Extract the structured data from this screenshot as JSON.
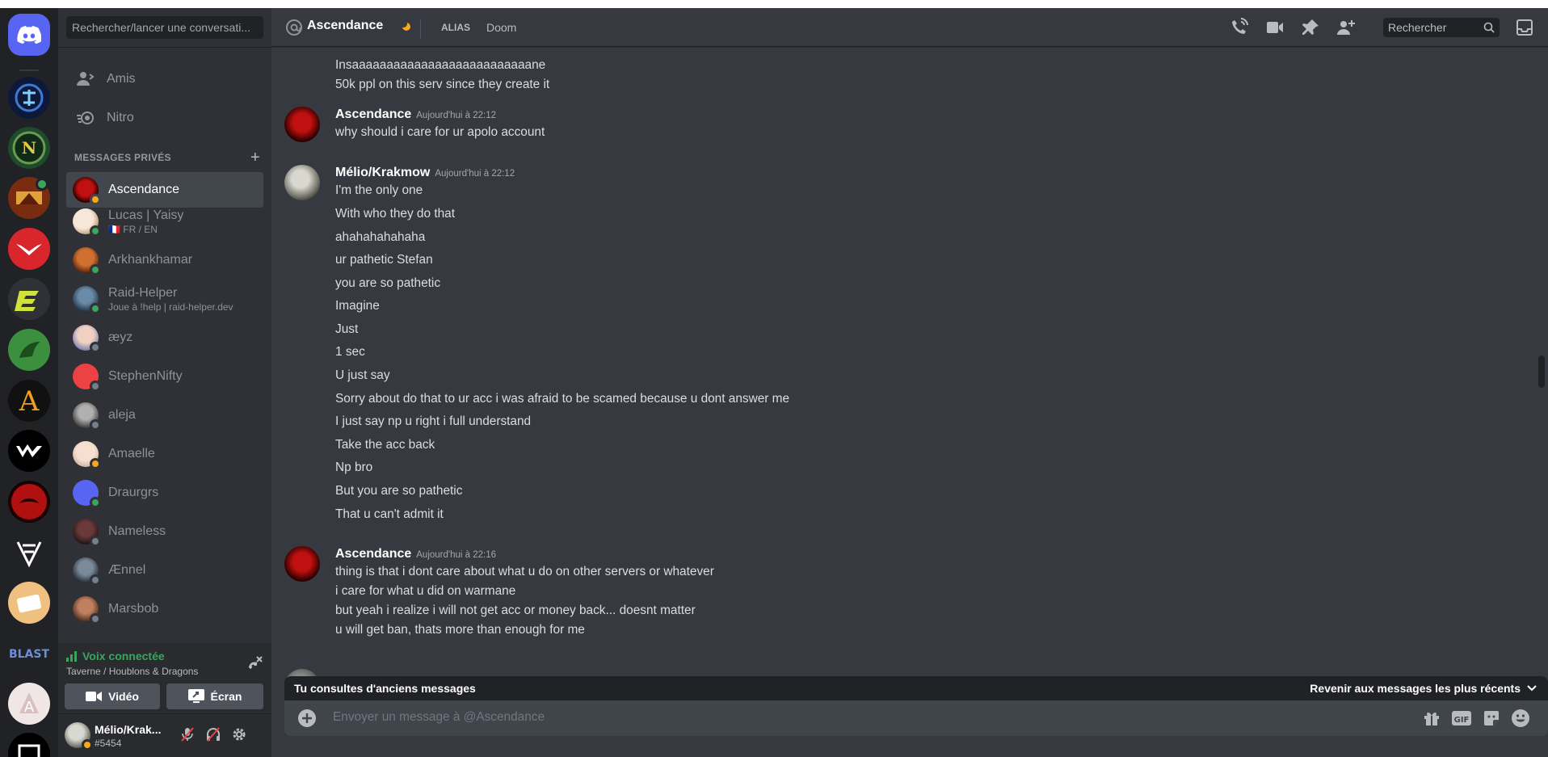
{
  "colors": {
    "accent": "#5865f2",
    "online": "#3ba55d",
    "idle": "#faa81a",
    "offline": "#747f8d"
  },
  "sidebar": {
    "search_placeholder": "Rechercher/lancer une conversati...",
    "nav": [
      {
        "label": "Amis",
        "icon": "friends-icon"
      },
      {
        "label": "Nitro",
        "icon": "nitro-icon"
      }
    ],
    "dm_header": "MESSAGES PRIVÉS",
    "dms": [
      {
        "name": "Ascendance",
        "status": "idle",
        "active": true
      },
      {
        "name": "Lucas | Yaisy",
        "sub": "🇫🇷 FR / EN",
        "status": "online"
      },
      {
        "name": "Arkhankhamar",
        "status": "online"
      },
      {
        "name": "Raid-Helper",
        "sub": "Joue à !help | raid-helper.dev",
        "status": "online"
      },
      {
        "name": "æyz",
        "status": "offline"
      },
      {
        "name": "StephenNifty",
        "status": "offline"
      },
      {
        "name": "aleja",
        "status": "offline"
      },
      {
        "name": "Amaelle",
        "status": "idle"
      },
      {
        "name": "Draurgrs",
        "status": "online"
      },
      {
        "name": "Nameless",
        "status": "offline"
      },
      {
        "name": "Ænnel",
        "status": "offline"
      },
      {
        "name": "Marsbob",
        "status": "offline"
      }
    ],
    "voice": {
      "status": "Voix connectée",
      "channel": "Taverne / Houblons & Dragons",
      "video_label": "Vidéo",
      "screen_label": "Écran"
    },
    "user": {
      "name": "Mélio/Krak...",
      "tag": "#5454"
    }
  },
  "header": {
    "channel": "Ascendance",
    "alias_label": "ALIAS",
    "alias_value": "Doom",
    "search_placeholder": "Rechercher"
  },
  "messages": {
    "orphans": [
      "Insaaaaaaaaaaaaaaaaaaaaaaaaaane",
      "50k ppl on this serv since they create it"
    ],
    "groups": [
      {
        "author": "Ascendance",
        "time": "Aujourd'hui à 22:12",
        "lines": [
          "why should i care for ur apolo account"
        ]
      },
      {
        "author": "Mélio/Krakmow",
        "time": "Aujourd'hui à 22:12",
        "lines": [
          "I'm the only one",
          "With who they do that",
          "ahahahahahaha",
          "ur pathetic Stefan",
          "you are so pathetic",
          "Imagine",
          "Just",
          "1 sec",
          "U just say",
          "Sorry about do that to ur acc i was afraid to be scamed because u dont answer me",
          "I just say np u right i full understand",
          "Take the acc back",
          "Np bro",
          "But you are so pathetic",
          "That u can't admit it"
        ]
      },
      {
        "author": "Ascendance",
        "time": "Aujourd'hui à 22:16",
        "lines": [
          "thing is that i dont care about what u do on other servers or whatever",
          "i care for what u did on warmane",
          "but yeah i realize i will not get acc or money back... doesnt matter",
          "u will get ban, thats more than enough for me"
        ]
      }
    ]
  },
  "jump": {
    "left": "Tu consultes d'anciens messages",
    "right": "Revenir aux messages les plus récents"
  },
  "composer": {
    "placeholder": "Envoyer un message à @Ascendance"
  }
}
